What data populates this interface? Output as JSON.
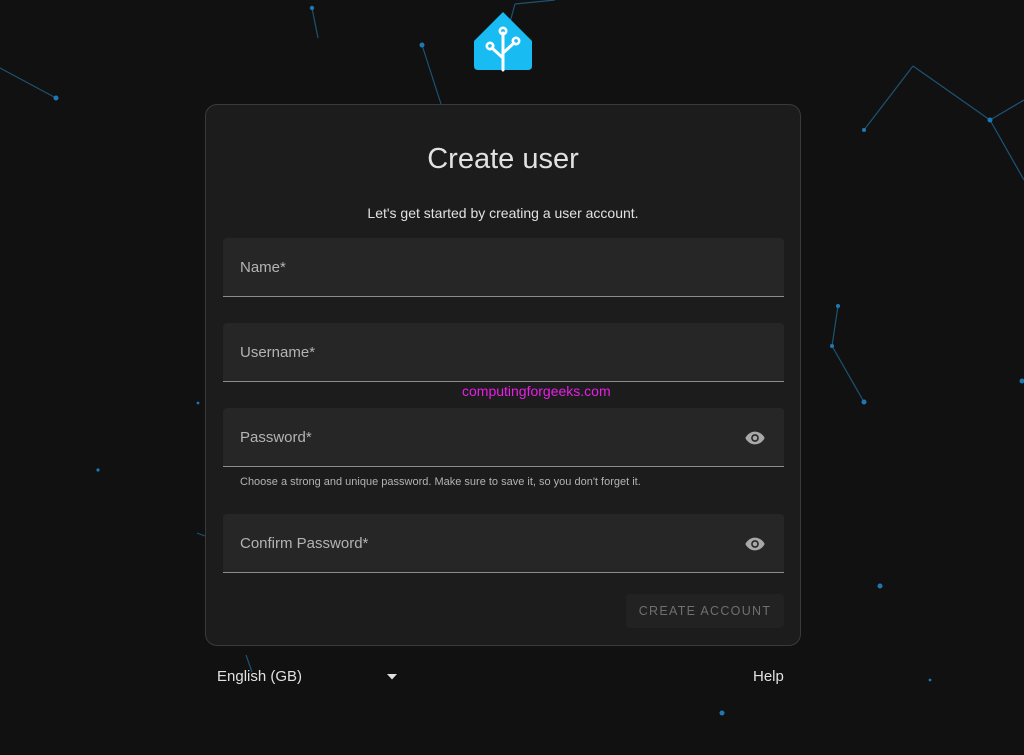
{
  "form": {
    "title": "Create user",
    "subtitle": "Let's get started by creating a user account.",
    "fields": {
      "name": {
        "label": "Name*"
      },
      "username": {
        "label": "Username*"
      },
      "password": {
        "label": "Password*",
        "helper": "Choose a strong and unique password. Make sure to save it, so you don't forget it."
      },
      "confirm_password": {
        "label": "Confirm Password*"
      }
    },
    "submit_label": "CREATE ACCOUNT"
  },
  "watermark": "computingforgeeks.com",
  "footer": {
    "language": "English (GB)",
    "help_label": "Help"
  },
  "icons": {
    "logo": "home-assistant-logo-icon",
    "password_toggle": "eye-icon",
    "language_dropdown": "caret-down-icon"
  },
  "colors": {
    "background": "#111111",
    "card": "#1c1c1c",
    "field": "#262626",
    "accent": "#18bcf2",
    "watermark": "#e91ee9"
  }
}
